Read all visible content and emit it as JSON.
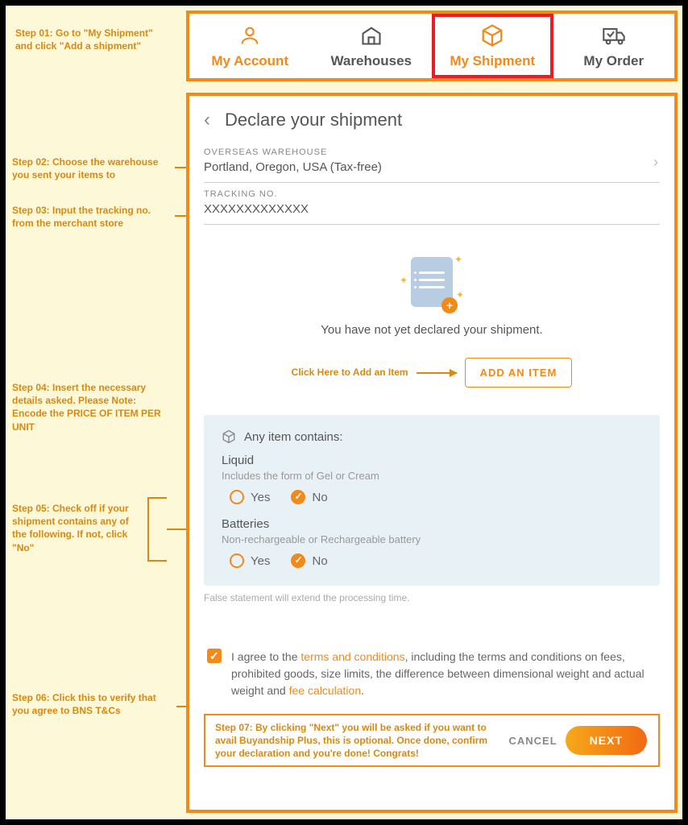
{
  "sidebar_steps": {
    "step1": "Step 01: Go to \"My Shipment\" and click \"Add a shipment\"",
    "step2": "Step 02: Choose the warehouse you sent your items to",
    "step3": "Step 03: Input the tracking no. from the merchant store",
    "step4": "Step 04: Insert the necessary details asked. Please Note: Encode the PRICE OF ITEM PER UNIT",
    "add_hint": "Click Here to Add an Item",
    "step5": "Step 05: Check off if your shipment contains any of the following. If not, click \"No\"",
    "step6": "Step 06: Click this to verify that you agree to BNS T&Cs",
    "step7": "Step 07: By clicking \"Next\" you will be asked if you want to avail Buyandship Plus, this is optional. Once done, confirm your declaration and you're done! Congrats!"
  },
  "nav": {
    "items": [
      {
        "label": "My Account"
      },
      {
        "label": "Warehouses"
      },
      {
        "label": "My Shipment"
      },
      {
        "label": "My Order"
      }
    ]
  },
  "page": {
    "title": "Declare your shipment",
    "warehouse_label": "OVERSEAS WAREHOUSE",
    "warehouse_value": "Portland, Oregon, USA (Tax-free)",
    "tracking_label": "TRACKING NO.",
    "tracking_value": "XXXXXXXXXXXXX",
    "empty_text": "You have not yet declared your shipment.",
    "add_item_label": "ADD AN ITEM",
    "contains": {
      "heading": "Any item contains:",
      "liquid_label": "Liquid",
      "liquid_sub": "Includes the form of Gel or Cream",
      "batteries_label": "Batteries",
      "batteries_sub": "Non-rechargeable or Rechargeable battery",
      "yes": "Yes",
      "no": "No",
      "disclaimer": "False statement will extend the processing time."
    },
    "agree_pre": "I agree to the ",
    "agree_link1": "terms and conditions",
    "agree_mid": ", including the terms and conditions on fees, prohibited goods, size limits, the difference between dimensional weight and actual weight and ",
    "agree_link2": "fee calculation",
    "agree_post": ".",
    "cancel": "CANCEL",
    "next": "NEXT"
  }
}
